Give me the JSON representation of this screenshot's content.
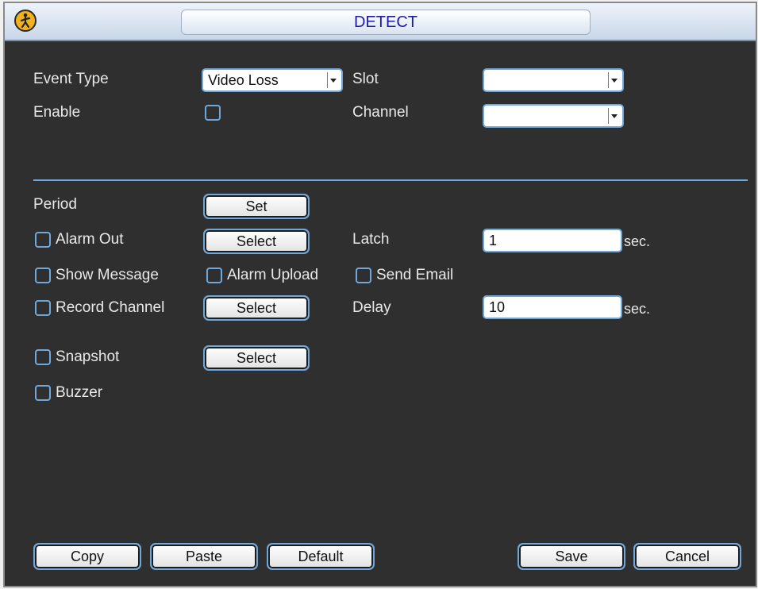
{
  "window": {
    "title": "DETECT"
  },
  "form": {
    "event_type_label": "Event Type",
    "event_type_value": "Video Loss",
    "slot_label": "Slot",
    "slot_value": "",
    "enable_label": "Enable",
    "enable_checked": false,
    "channel_label": "Channel",
    "channel_value": ""
  },
  "actions": {
    "period_label": "Period",
    "period_button": "Set",
    "alarm_out_label": "Alarm Out",
    "alarm_out_button": "Select",
    "latch_label": "Latch",
    "latch_value": "1",
    "latch_unit": "sec.",
    "show_message_label": "Show Message",
    "alarm_upload_label": "Alarm Upload",
    "send_email_label": "Send Email",
    "record_channel_label": "Record Channel",
    "record_channel_button": "Select",
    "delay_label": "Delay",
    "delay_value": "10",
    "delay_unit": "sec.",
    "snapshot_label": "Snapshot",
    "snapshot_button": "Select",
    "buzzer_label": "Buzzer"
  },
  "footer": {
    "copy": "Copy",
    "paste": "Paste",
    "default": "Default",
    "save": "Save",
    "cancel": "Cancel"
  }
}
